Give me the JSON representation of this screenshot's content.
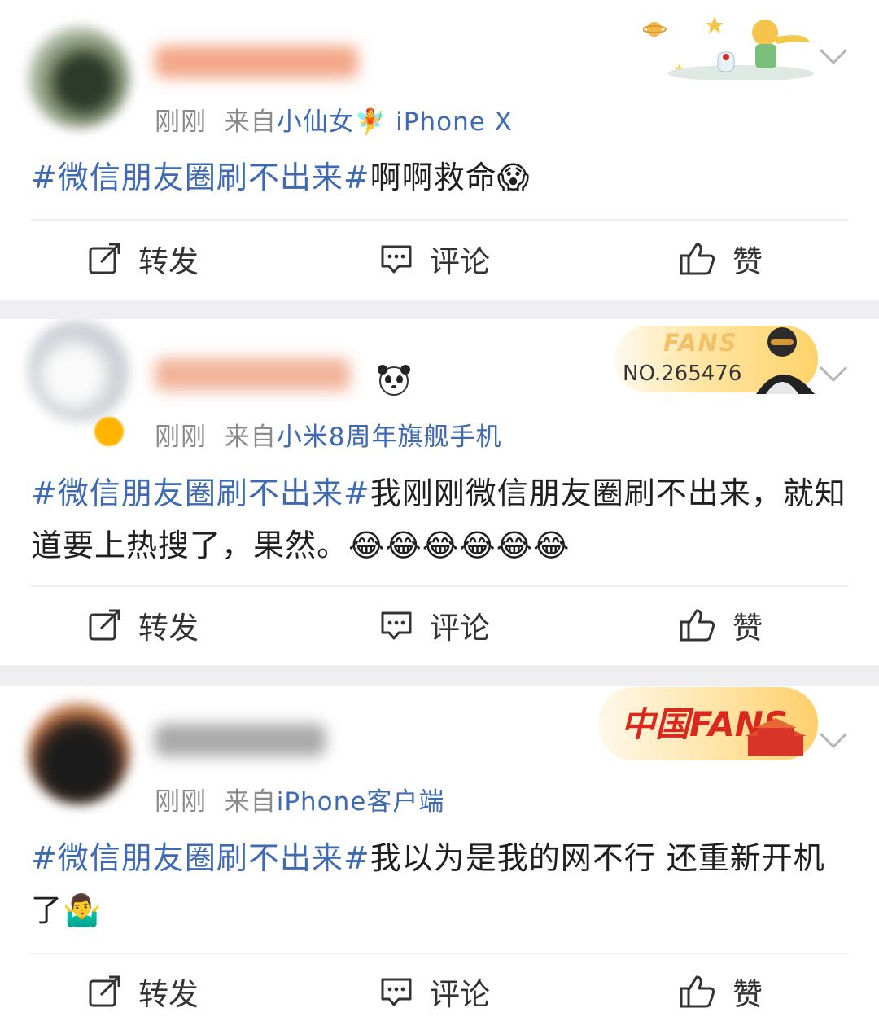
{
  "posts": [
    {
      "time": "刚刚",
      "source_prefix": "来自",
      "source": "小仙女🧚 iPhone X",
      "hashtag": "#微信朋友圈刷不出来#",
      "text": "啊啊救命😱",
      "actions": {
        "repost": "转发",
        "comment": "评论",
        "like": "赞"
      }
    },
    {
      "time": "刚刚",
      "source_prefix": "来自",
      "source": "小米8周年旗舰手机",
      "hashtag": "#微信朋友圈刷不出来#",
      "text": "我刚刚微信朋友圈刷不出来，就知道要上热搜了，果然。😂😂😂😂😂😂",
      "fans_badge": {
        "label": "FANS",
        "number": "NO.265476"
      },
      "actions": {
        "repost": "转发",
        "comment": "评论",
        "like": "赞"
      }
    },
    {
      "time": "刚刚",
      "source_prefix": "来自",
      "source": "iPhone客户端",
      "hashtag": "#微信朋友圈刷不出来#",
      "text": "我以为是我的网不行 还重新开机了🤷‍♂️",
      "china_badge": {
        "label": "中国FANS"
      },
      "actions": {
        "repost": "转发",
        "comment": "评论",
        "like": "赞"
      }
    }
  ],
  "colors": {
    "link": "#3d6ab3",
    "meta": "#8a8a8a",
    "text": "#1f1f1f",
    "background": "#efeff1"
  },
  "icons": {
    "repost": "share-arrow-icon",
    "comment": "comment-bubble-icon",
    "like": "thumbs-up-icon",
    "more": "chevron-down-icon"
  }
}
